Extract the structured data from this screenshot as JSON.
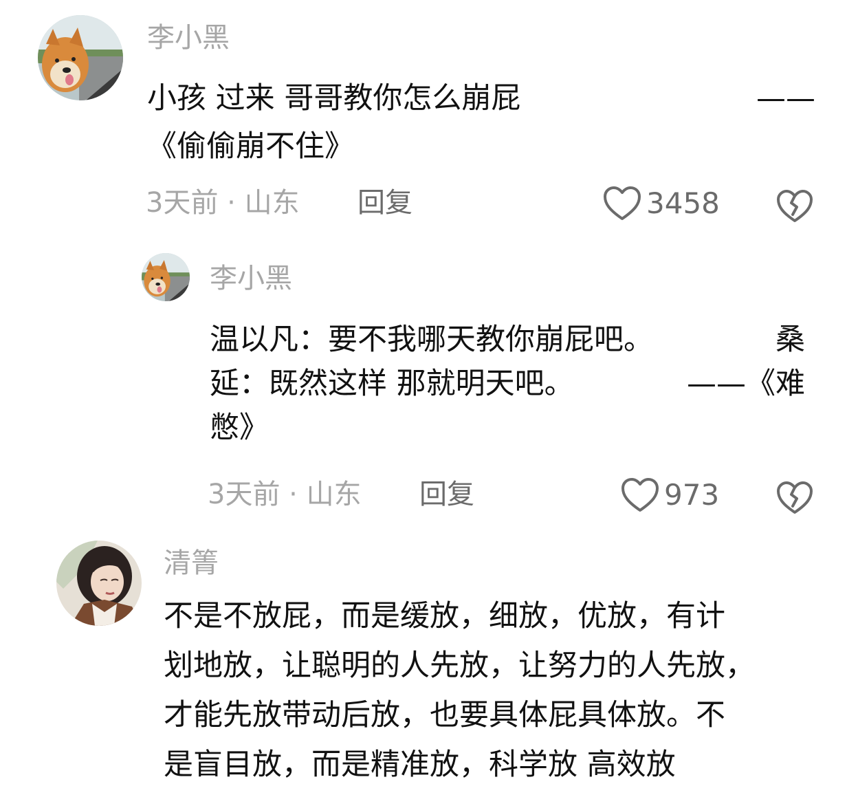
{
  "comments": [
    {
      "username": "李小黑",
      "text_line1": "小孩 过来 哥哥教你怎么崩屁",
      "text_dash": "——",
      "text_line2": "《偷偷崩不住》",
      "time_location": "3天前 · 山东",
      "reply_label": "回复",
      "likes": "3458",
      "avatar_icon": "shiba-dog-avatar"
    }
  ],
  "reply": {
    "username": "李小黑",
    "line1": "温以凡：要不我哪天教你崩屁吧。",
    "line1_tail": "桑",
    "line2": "延：既然这样 那就明天吧。",
    "line2_tail": "——《难",
    "line3": "憋》",
    "time_location": "3天前 · 山东",
    "reply_label": "回复",
    "likes": "973",
    "avatar_icon": "shiba-dog-avatar"
  },
  "comment2": {
    "username": "清箐",
    "line1": "不是不放屁，而是缓放，细放，优放，有计",
    "line2": "划地放，让聪明的人先放，让努力的人先放，",
    "line3": "才能先放带动后放，也要具体屁具体放。不",
    "line4": "是盲目放，而是精准放，科学放 高效放",
    "avatar_icon": "girl-portrait-avatar"
  },
  "icons": {
    "like": "heart-outline-icon",
    "dislike": "broken-heart-icon"
  },
  "colors": {
    "text": "#111111",
    "meta": "#a6a6a6",
    "icon": "#6b6b6b"
  }
}
